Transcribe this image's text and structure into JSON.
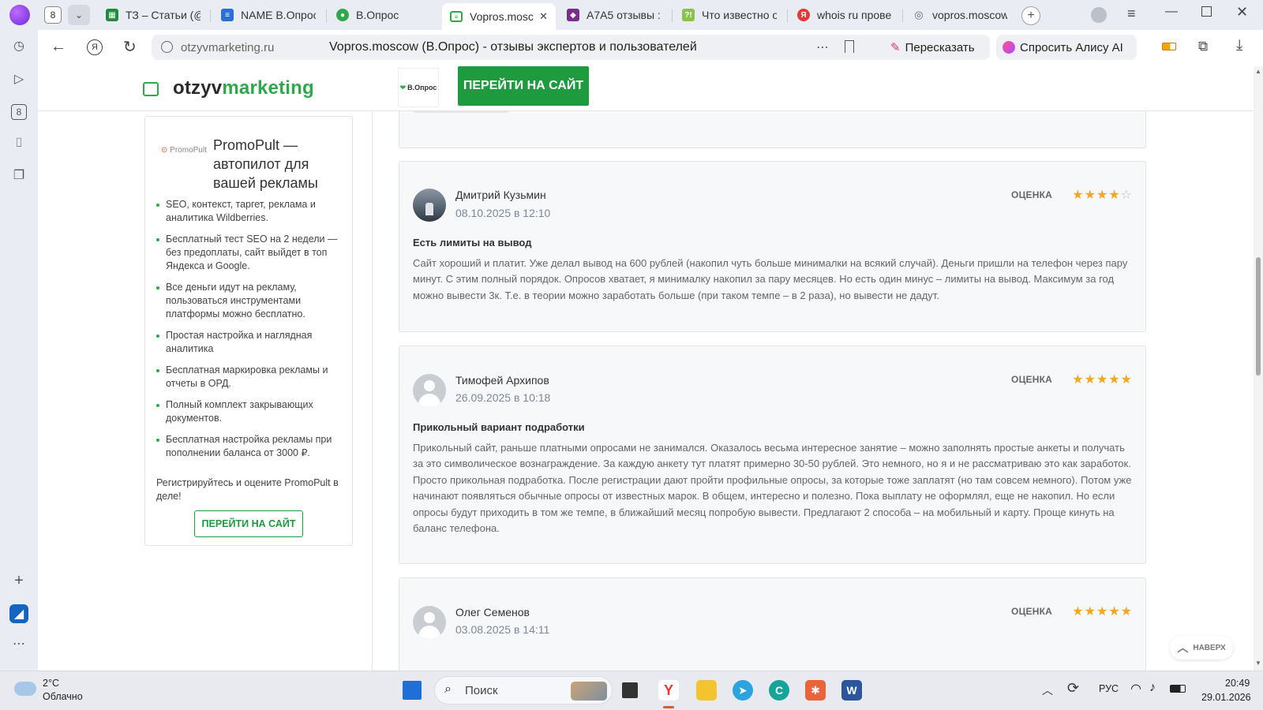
{
  "browser": {
    "tab_count": "8",
    "tabs": [
      {
        "label": "ТЗ – Статьи (@",
        "favicon": "sheets-icon",
        "color": "#1e8e3e"
      },
      {
        "label": "NAME В.Опрос",
        "favicon": "docs-icon",
        "color": "#2b6fd6"
      },
      {
        "label": "В.Опрос",
        "favicon": "vopros-icon",
        "color": "#2ea84a"
      },
      {
        "label": "Vopros.mosc",
        "favicon": "otzyv-icon",
        "color": "#2ea84a",
        "active": true
      },
      {
        "label": "A7A5 отзывы :",
        "favicon": "purple-icon",
        "color": "#7b2d8e"
      },
      {
        "label": "Что известно о",
        "favicon": "question-icon",
        "color": "#8bc34a"
      },
      {
        "label": "whois ru провер",
        "favicon": "yandex-icon",
        "color": "#e53935"
      },
      {
        "label": "vopros.moscow",
        "favicon": "globe-icon",
        "color": "#888888"
      }
    ],
    "url": "otzyvmarketing.ru",
    "page_title": "Vopros.moscow (В.Опрос) - отзывы экспертов и пользователей",
    "retell_label": "Пересказать",
    "alice_label": "Спросить Алису AI"
  },
  "site": {
    "logo_prefix": "otzyv",
    "logo_suffix": "marketing",
    "header_brand": "В.Опрос",
    "header_button": "ПЕРЕЙТИ НА САЙТ",
    "accent_color": "#1e9b3f",
    "to_top_label": "НАВЕРХ"
  },
  "promo": {
    "logo_text": "PromoPult",
    "title": "PromoPult — автопилот для вашей рекламы",
    "items": [
      "SEO, контекст, таргет, реклама и аналитика Wildberries.",
      "Бесплатный тест SEO на 2 недели — без предоплаты, сайт выйдет в топ Яндекса и Google.",
      "Все деньги идут на рекламу, пользоваться инструментами платформы можно бесплатно.",
      "Простая настройка и наглядная аналитика",
      "Бесплатная маркировка рекламы и отчеты в ОРД.",
      "Полный комплект закрывающих документов.",
      "Бесплатная настройка рекламы при пополнении баланса от 3000 ₽."
    ],
    "cta_text": "Регистрируйтесь и оцените PromoPult в деле!",
    "button": "ПЕРЕЙТИ НА САЙТ"
  },
  "reviews": [
    {
      "author": "Дмитрий Кузьмин",
      "date": "08.10.2025 в 12:10",
      "rating_label": "ОЦЕНКА",
      "rating": 4,
      "title": "Есть лимиты на вывод",
      "body": "Сайт хороший и платит. Уже делал вывод на 600 рублей (накопил чуть больше минималки на всякий случай). Деньги пришли на телефон через пару минут. С этим полный порядок. Опросов хватает, я минималку накопил за пару месяцев. Но есть один минус – лимиты на вывод. Максимум за год можно вывести 3к. Т.е. в теории можно заработать больше (при таком темпе – в 2 раза), но вывести не дадут."
    },
    {
      "author": "Тимофей Архипов",
      "date": "26.09.2025 в 10:18",
      "rating_label": "ОЦЕНКА",
      "rating": 5,
      "title": "Прикольный вариант подработки",
      "body": "Прикольный сайт, раньше платными опросами не занимался. Оказалось весьма интересное занятие – можно заполнять простые анкеты и получать за это символическое вознаграждение. За каждую анкету тут платят примерно 30-50 рублей. Это немного, но я и не рассматриваю это как заработок. Просто прикольная подработка. После регистрации дают пройти профильные опросы, за которые тоже заплатят (но там совсем немного). Потом уже начинают появляться обычные опросы от известных марок. В общем, интересно и полезно. Пока выплату не оформлял, еще не накопил. Но если опросы будут приходить в том же темпе, в ближайший месяц попробую вывести. Предлагают 2 способа – на мобильный и карту. Проще кинуть на баланс телефона."
    },
    {
      "author": "Олег Семенов",
      "date": "03.08.2025 в 14:11",
      "rating_label": "ОЦЕНКА",
      "rating": 5
    }
  ],
  "taskbar": {
    "temperature": "2°C",
    "weather": "Облачно",
    "search_placeholder": "Поиск",
    "language": "РУС",
    "time": "20:49",
    "date": "29.01.2026"
  }
}
